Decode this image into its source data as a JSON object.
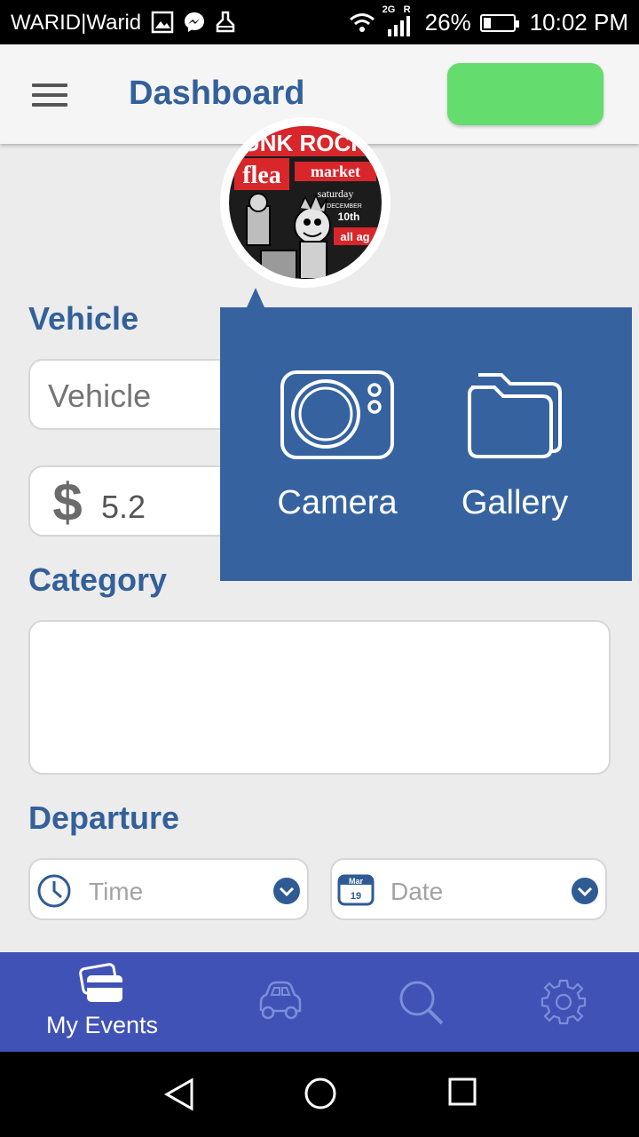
{
  "status_bar": {
    "carrier": "WARID|Warid",
    "network": "2G",
    "roaming": "R",
    "battery_percent": "26%",
    "time": "10:02 PM"
  },
  "toolbar": {
    "title": "Dashboard",
    "accent_button_color": "#64dc6e"
  },
  "avatar": {
    "poster_line1": "UNK ROCK",
    "poster_line2": "flea",
    "poster_line3": "market",
    "poster_line4": "saturday",
    "poster_line5": "DECEMBER",
    "poster_line6": "10th",
    "poster_line7": "all ag"
  },
  "form": {
    "vehicle_label": "Vehicle",
    "vehicle_placeholder": "Vehicle",
    "price_value": "5.2",
    "category_label": "Category",
    "departure_label": "Departure",
    "time_placeholder": "Time",
    "date_placeholder": "Date",
    "calendar_month": "Mar",
    "calendar_day": "19"
  },
  "popup": {
    "camera_label": "Camera",
    "gallery_label": "Gallery",
    "background_color": "#3663a0"
  },
  "bottom_nav": {
    "background_color": "#4052b5",
    "items": [
      {
        "label": "My Events",
        "icon": "cards-icon",
        "active": true
      },
      {
        "label": "",
        "icon": "car-icon",
        "active": false
      },
      {
        "label": "",
        "icon": "search-icon",
        "active": false
      },
      {
        "label": "",
        "icon": "gear-icon",
        "active": false
      }
    ]
  },
  "colors": {
    "brand": "#33609a",
    "background": "#ececec"
  }
}
